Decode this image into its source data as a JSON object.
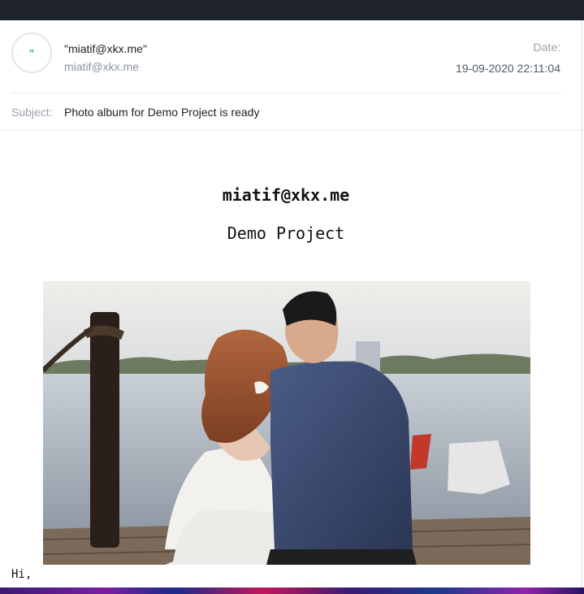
{
  "email": {
    "avatar_glyph": "\"",
    "sender_name": "\"miatif@xkx.me\"",
    "sender_email": "miatif@xkx.me",
    "date_label": "Date:",
    "date_value": "19-09-2020 22:11:04",
    "subject_label": "Subject:",
    "subject_value": "Photo album for Demo Project is ready"
  },
  "body": {
    "title": "miatif@xkx.me",
    "subtitle": "Demo Project",
    "greeting": "Hi,"
  },
  "colors": {
    "topbar": "#1f232d",
    "avatar_accent": "#20b1a6"
  }
}
